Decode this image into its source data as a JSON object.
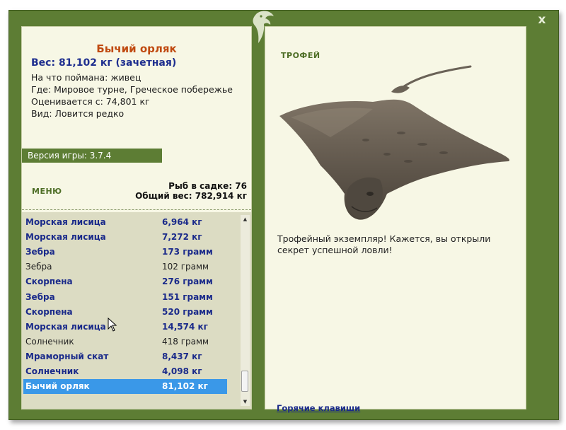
{
  "window": {
    "close_label": "x"
  },
  "fish": {
    "title": "Бычий орляк",
    "weight": "Вес: 81,102 кг (зачетная)",
    "caught_with": "На что поймана: живец",
    "location": "Где: Мировое турне, Греческое побережье",
    "value": "Оценивается с: 74,801 кг",
    "rarity": "Вид: Ловится редко"
  },
  "version": "Версия игры: 3.7.4",
  "menu_label": "МЕНЮ",
  "stats": {
    "count": "Рыб в садке: 76",
    "total": "Общий вес: 782,914 кг"
  },
  "catch_list": [
    {
      "name": "Морская лисица",
      "weight": "6,964 кг",
      "trophy": true
    },
    {
      "name": "Морская лисица",
      "weight": "7,272 кг",
      "trophy": true
    },
    {
      "name": "Зебра",
      "weight": "173 грамм",
      "trophy": true
    },
    {
      "name": "Зебра",
      "weight": "102 грамм",
      "trophy": false
    },
    {
      "name": "Скорпена",
      "weight": "276 грамм",
      "trophy": true
    },
    {
      "name": "Зебра",
      "weight": "151 грамм",
      "trophy": true
    },
    {
      "name": "Скорпена",
      "weight": "520 грамм",
      "trophy": true
    },
    {
      "name": "Морская лисица",
      "weight": "14,574 кг",
      "trophy": true
    },
    {
      "name": "Солнечник",
      "weight": "418 грамм",
      "trophy": false
    },
    {
      "name": "Мраморный скат",
      "weight": "8,437 кг",
      "trophy": true
    },
    {
      "name": "Солнечник",
      "weight": "4,098 кг",
      "trophy": true
    },
    {
      "name": "Бычий орляк",
      "weight": "81,102 кг",
      "trophy": true,
      "selected": true
    }
  ],
  "right": {
    "trophy_label": "ТРОФЕЙ",
    "message": "Трофейный экземпляр! Кажется, вы открыли секрет успешной ловли!",
    "hotkeys_label": "Горячие клавиши"
  },
  "colors": {
    "frame": "#5d7d34",
    "panel": "#f7f7e5",
    "trophy_text": "#1a2a8a",
    "title": "#c04a10",
    "selection": "#3a98e8"
  }
}
